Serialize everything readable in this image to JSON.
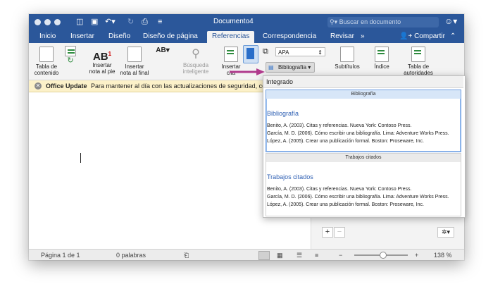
{
  "window": {
    "title": "Documento4"
  },
  "search": {
    "placeholder": "Buscar en documento"
  },
  "tabs": [
    "Inicio",
    "Insertar",
    "Diseño",
    "Diseño de página",
    "Referencias",
    "Correspondencia",
    "Revisar"
  ],
  "tabs_more": "»",
  "active_tab": "Referencias",
  "share_label": "Compartir",
  "ribbon": {
    "toc_label": "Tabla de contenido",
    "footnote_label": "Insertar nota al pie",
    "endnote_label": "Insertar nota al final",
    "smart_lookup_label": "Búsqueda inteligente",
    "insert_citation_label": "Insertar cita",
    "style_value": "APA",
    "bibliography_label": "Bibliografía",
    "captions_label": "Subtítulos",
    "index_label": "Índice",
    "toa_label": "Tabla de autoridades"
  },
  "infobar": {
    "title": "Office Update",
    "message": "Para mantener al día con las actualizaciones de seguridad, con"
  },
  "status": {
    "page": "Página 1 de 1",
    "words": "0 palabras",
    "zoom": "138 %",
    "zoom_minus": "−",
    "zoom_plus": "+"
  },
  "gallery": {
    "header": "Integrado",
    "items": [
      {
        "bar": "Bibliografía",
        "title": "Bibliografía",
        "lines": [
          "Benito, A. (2003). Citas y referencias. Nueva York: Contoso Press.",
          "García, M. D. (2006). Cómo escribir una bibliografía. Lima: Adventure Works Press.",
          "López, A. (2005). Crear una publicación formal. Boston: Proseware, Inc."
        ]
      },
      {
        "bar": "Trabajos citados",
        "title": "Trabajos citados",
        "lines": [
          "Benito, A. (2003). Citas y referencias. Nueva York: Contoso Press.",
          "García, M. D. (2006). Cómo escribir una bibliografía. Lima: Adventure Works Press.",
          "López, A. (2005). Crear una publicación formal. Boston: Proseware, Inc."
        ]
      }
    ]
  },
  "colors": {
    "accent": "#2b579a",
    "infobar": "#fcf1c9",
    "link": "#2e5fb3"
  }
}
